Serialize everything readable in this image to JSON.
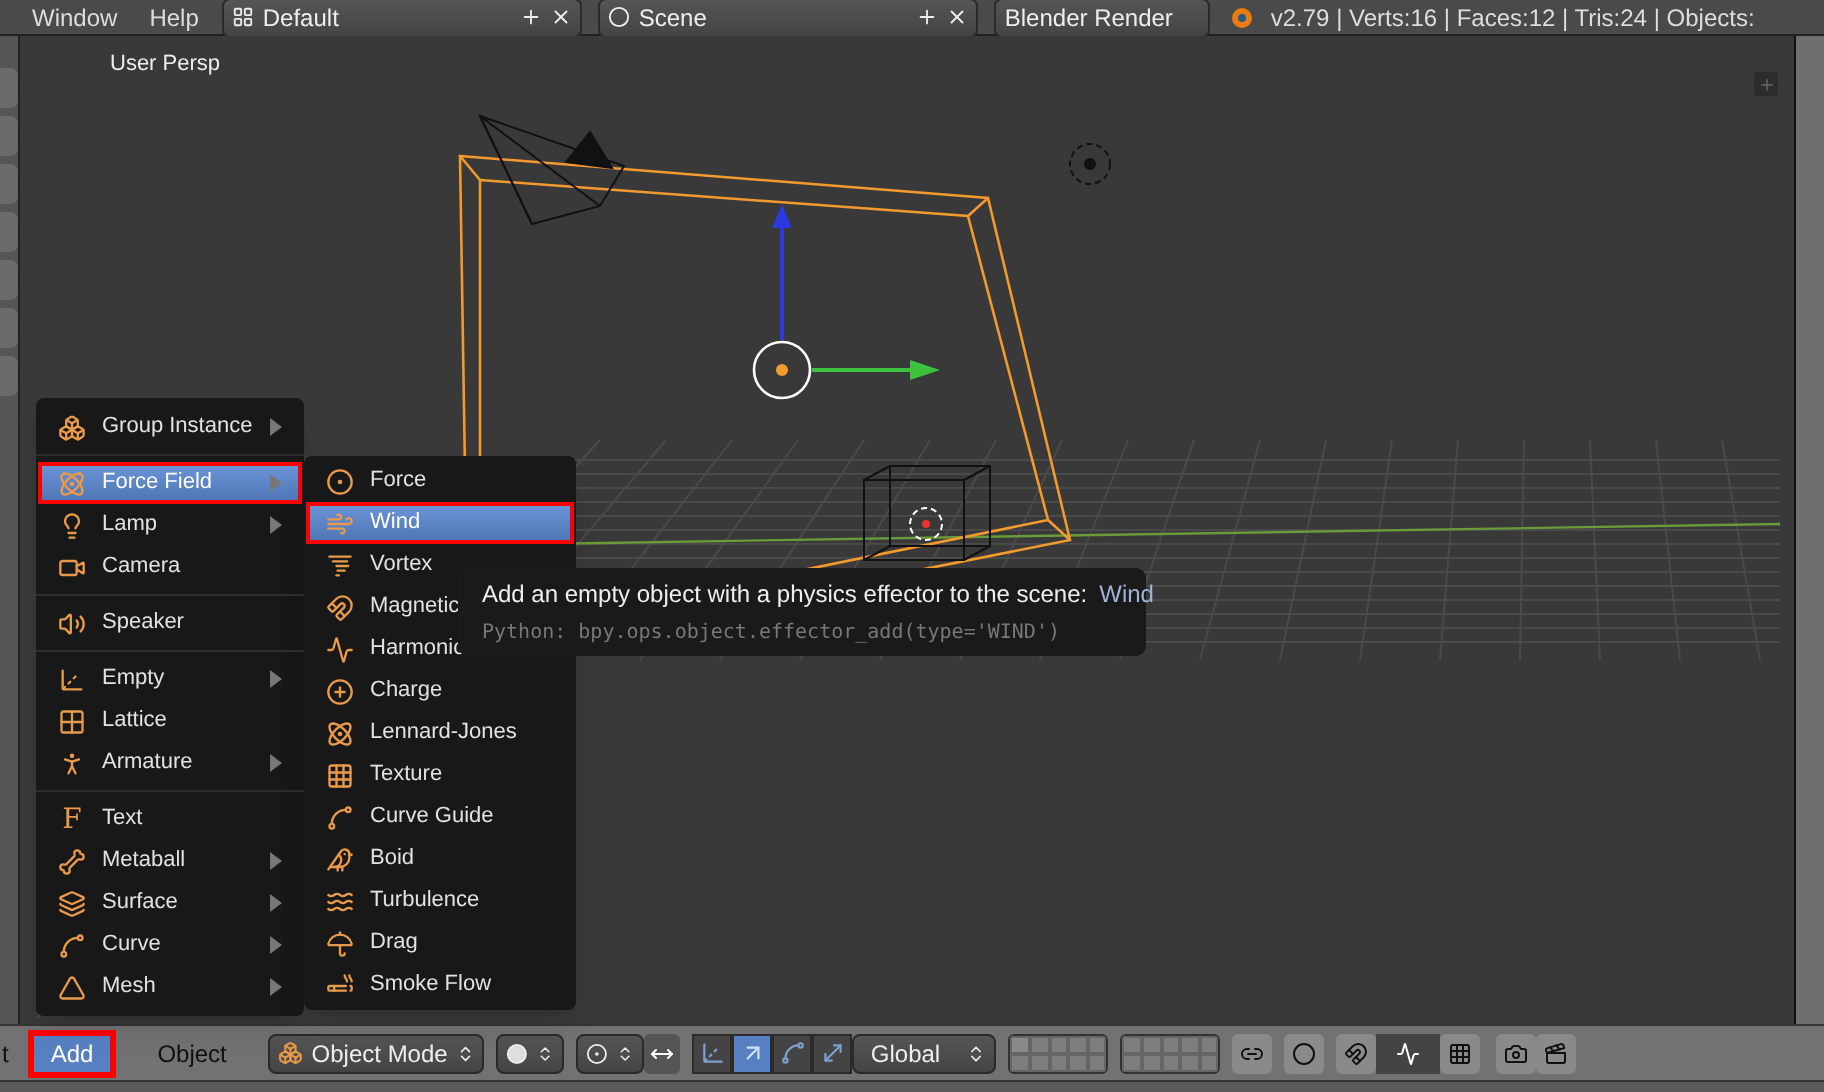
{
  "top_bar": {
    "menus": [
      "Window",
      "Help"
    ],
    "screen_layout": "Default",
    "scene": "Scene",
    "render_engine": "Blender Render",
    "stats": "v2.79 | Verts:16 | Faces:12 | Tris:24 | Objects:"
  },
  "viewport": {
    "label": "User Persp"
  },
  "add_menu": {
    "sections": [
      [
        {
          "label": "Group Instance",
          "submenu": true,
          "selected": false,
          "highlighted": false
        }
      ],
      [
        {
          "label": "Force Field",
          "submenu": true,
          "selected": true,
          "highlighted": true
        },
        {
          "label": "Lamp",
          "submenu": true,
          "selected": false,
          "highlighted": false
        },
        {
          "label": "Camera",
          "submenu": false,
          "selected": false,
          "highlighted": false
        }
      ],
      [
        {
          "label": "Speaker",
          "submenu": false,
          "selected": false,
          "highlighted": false
        }
      ],
      [
        {
          "label": "Empty",
          "submenu": true,
          "selected": false,
          "highlighted": false
        },
        {
          "label": "Lattice",
          "submenu": false,
          "selected": false,
          "highlighted": false
        },
        {
          "label": "Armature",
          "submenu": true,
          "selected": false,
          "highlighted": false
        }
      ],
      [
        {
          "label": "Text",
          "glyph": "F",
          "submenu": false,
          "selected": false,
          "highlighted": false
        },
        {
          "label": "Metaball",
          "submenu": true,
          "selected": false,
          "highlighted": false
        },
        {
          "label": "Surface",
          "submenu": true,
          "selected": false,
          "highlighted": false
        },
        {
          "label": "Curve",
          "submenu": true,
          "selected": false,
          "highlighted": false
        },
        {
          "label": "Mesh",
          "submenu": true,
          "selected": false,
          "highlighted": false
        }
      ]
    ]
  },
  "force_field_menu": {
    "items": [
      {
        "label": "Force",
        "selected": false,
        "highlighted": false
      },
      {
        "label": "Wind",
        "selected": true,
        "highlighted": true
      },
      {
        "label": "Vortex",
        "selected": false,
        "highlighted": false
      },
      {
        "label": "Magnetic",
        "selected": false,
        "highlighted": false
      },
      {
        "label": "Harmonic",
        "selected": false,
        "highlighted": false
      },
      {
        "label": "Charge",
        "selected": false,
        "highlighted": false
      },
      {
        "label": "Lennard-Jones",
        "selected": false,
        "highlighted": false
      },
      {
        "label": "Texture",
        "selected": false,
        "highlighted": false
      },
      {
        "label": "Curve Guide",
        "selected": false,
        "highlighted": false
      },
      {
        "label": "Boid",
        "selected": false,
        "highlighted": false
      },
      {
        "label": "Turbulence",
        "selected": false,
        "highlighted": false
      },
      {
        "label": "Drag",
        "selected": false,
        "highlighted": false
      },
      {
        "label": "Smoke Flow",
        "selected": false,
        "highlighted": false
      }
    ]
  },
  "tooltip": {
    "description": "Add an empty object with a physics effector to the scene:",
    "value": "Wind",
    "python": "Python: bpy.ops.object.effector_add(type='WIND')"
  },
  "header": {
    "cut_label": "t",
    "menus": [
      {
        "label": "Add",
        "selected": true,
        "highlighted": true
      },
      {
        "label": "Object",
        "selected": false,
        "highlighted": false
      }
    ],
    "mode": "Object Mode",
    "manipulators": [
      {
        "selected": false
      },
      {
        "selected": true
      },
      {
        "selected": false
      },
      {
        "selected": false
      }
    ],
    "orientation": "Global"
  }
}
